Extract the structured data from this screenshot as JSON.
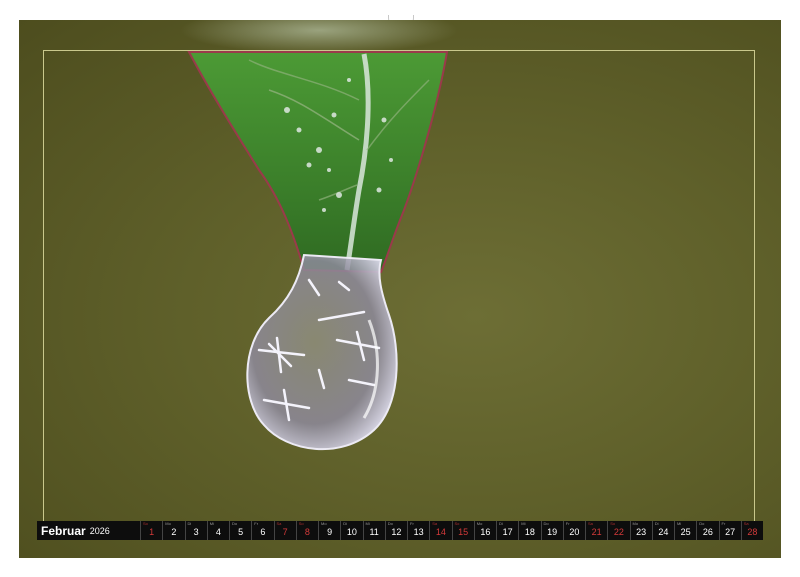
{
  "calendar": {
    "month": "Februar",
    "year": "2026",
    "weekend_color": "#d43a3a",
    "days": [
      {
        "wd": "So",
        "num": "1",
        "weekend": true
      },
      {
        "wd": "Mo",
        "num": "2",
        "weekend": false
      },
      {
        "wd": "Di",
        "num": "3",
        "weekend": false
      },
      {
        "wd": "Mi",
        "num": "4",
        "weekend": false
      },
      {
        "wd": "Do",
        "num": "5",
        "weekend": false
      },
      {
        "wd": "Fr",
        "num": "6",
        "weekend": false
      },
      {
        "wd": "Sa",
        "num": "7",
        "weekend": true
      },
      {
        "wd": "So",
        "num": "8",
        "weekend": true
      },
      {
        "wd": "Mo",
        "num": "9",
        "weekend": false
      },
      {
        "wd": "Di",
        "num": "10",
        "weekend": false
      },
      {
        "wd": "Mi",
        "num": "11",
        "weekend": false
      },
      {
        "wd": "Do",
        "num": "12",
        "weekend": false
      },
      {
        "wd": "Fr",
        "num": "13",
        "weekend": false
      },
      {
        "wd": "Sa",
        "num": "14",
        "weekend": true
      },
      {
        "wd": "So",
        "num": "15",
        "weekend": true
      },
      {
        "wd": "Mo",
        "num": "16",
        "weekend": false
      },
      {
        "wd": "Di",
        "num": "17",
        "weekend": false
      },
      {
        "wd": "Mi",
        "num": "18",
        "weekend": false
      },
      {
        "wd": "Do",
        "num": "19",
        "weekend": false
      },
      {
        "wd": "Fr",
        "num": "20",
        "weekend": false
      },
      {
        "wd": "Sa",
        "num": "21",
        "weekend": true
      },
      {
        "wd": "So",
        "num": "22",
        "weekend": true
      },
      {
        "wd": "Mo",
        "num": "23",
        "weekend": false
      },
      {
        "wd": "Di",
        "num": "24",
        "weekend": false
      },
      {
        "wd": "Mi",
        "num": "25",
        "weekend": false
      },
      {
        "wd": "Do",
        "num": "26",
        "weekend": false
      },
      {
        "wd": "Fr",
        "num": "27",
        "weekend": false
      },
      {
        "wd": "Sa",
        "num": "28",
        "weekend": true
      }
    ]
  },
  "photo": {
    "subject": "leaf-tip-with-water-drop",
    "background_color": "#5f602a",
    "leaf_color": "#3f8a2e",
    "frame_color": "#c9c88c"
  }
}
